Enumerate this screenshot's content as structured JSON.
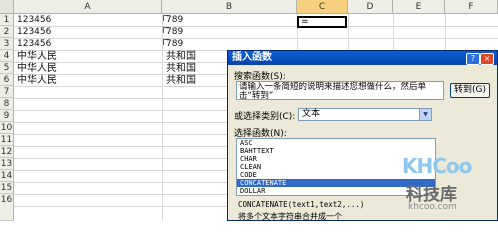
{
  "sheet": {
    "columns": [
      "A",
      "B",
      "C",
      "D",
      "E",
      "F"
    ],
    "rows": [
      "1",
      "2",
      "3",
      "4",
      "5",
      "6",
      "7",
      "8",
      "9",
      "10",
      "11",
      "12",
      "13",
      "14",
      "15",
      "16"
    ],
    "cells": {
      "a1": "123456",
      "a2": "123456",
      "a3": "123456",
      "a4": "中华人民",
      "a5": "中华人民",
      "a6": "中华人民",
      "b1": "789",
      "b2": "789",
      "b3": "789",
      "b4": "共和国",
      "b5": "共和国",
      "b6": "共和国",
      "c2": "="
    }
  },
  "dialog": {
    "title": "插入函数",
    "help": "?",
    "close": "×",
    "search_label": "搜索函数(S):",
    "search_text": "请输入一条简短的说明来描述您想做什么，然后单击“转到”",
    "go_button": "转到(G)",
    "category_label": "或选择类别(C):",
    "category_value": "文本",
    "function_label": "选择函数(N):",
    "functions": [
      "ASC",
      "BAHTTEXT",
      "CHAR",
      "CLEAN",
      "CODE",
      "CONCATENATE",
      "DOLLAR"
    ],
    "selected_function": "CONCATENATE",
    "syntax": "CONCATENATE(text1,text2,...)",
    "description": "将多个文本字符串合并成一个"
  },
  "watermark": {
    "logo": "KHCoo",
    "name": "科技库",
    "url": "khcoo.com"
  }
}
